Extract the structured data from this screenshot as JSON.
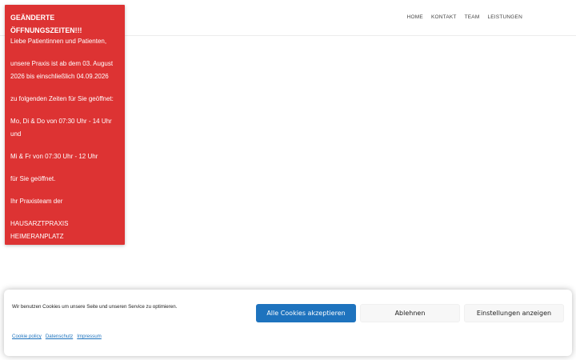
{
  "nav": {
    "items": [
      "HOME",
      "KONTAKT",
      "TEAM",
      "LEISTUNGEN"
    ]
  },
  "notice": {
    "title_line1": "GEÄNDERTE",
    "title_line2": "ÖFFNUNGSZEITEN!!!",
    "paragraphs": [
      "Liebe Patientinnen und Patienten,",
      "unsere Praxis ist ab dem 03. August 2026 bis einschließlich 04.09.2026",
      "zu folgenden Zeiten für Sie geöffnet:",
      "Mo, Di & Do von 07:30 Uhr - 14 Uhr und",
      "Mi & Fr von 07:30 Uhr - 12 Uhr",
      "für Sie geöffnet.",
      "Ihr Praxisteam der",
      "HAUSARZTPRAXIS HEIMERANPLATZ"
    ],
    "background_color": "#dd3333"
  },
  "cookie_banner": {
    "message": "Wir benutzen Cookies um unsere Seite und unseren Service zu optimieren.",
    "accept_label": "Alle Cookies akzeptieren",
    "deny_label": "Ablehnen",
    "settings_label": "Einstellungen anzeigen",
    "links": [
      "Cookie policy",
      "Datenschutz",
      "Impressum"
    ],
    "accent_color": "#1e73be"
  }
}
